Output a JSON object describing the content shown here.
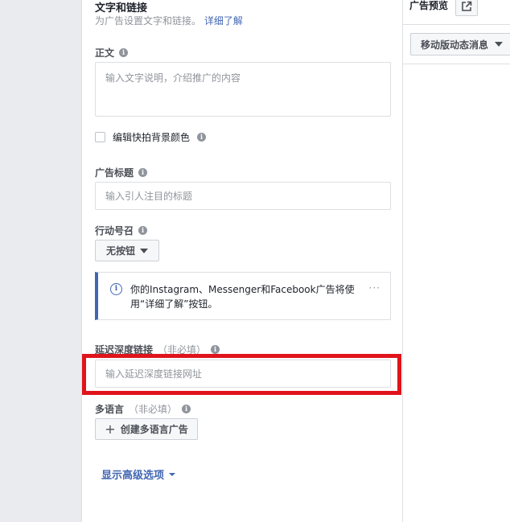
{
  "text_links": {
    "title": "文字和链接",
    "subtitle": "为广告设置文字和链接。",
    "learn_more": "详细了解"
  },
  "body_text": {
    "label": "正文",
    "placeholder": "输入文字说明，介绍推广的内容"
  },
  "snapshot_bg": {
    "label": "编辑快拍背景颜色"
  },
  "headline": {
    "label": "广告标题",
    "placeholder": "输入引人注目的标题"
  },
  "cta": {
    "label": "行动号召",
    "value": "无按钮"
  },
  "notice": {
    "text": "你的Instagram、Messenger和Facebook广告将使用“详细了解”按钮。",
    "more": "···"
  },
  "deep_link": {
    "label": "延迟深度链接",
    "optional": "（非必填）",
    "placeholder": "输入延迟深度链接网址"
  },
  "multilang": {
    "label": "多语言",
    "optional": "（非必填）",
    "button": "创建多语言广告"
  },
  "advanced": {
    "label": "显示高级选项"
  },
  "preview": {
    "title": "广告预览",
    "placement": "移动版动态消息"
  },
  "colors": {
    "accent": "#4267b2",
    "highlight": "#e0141b"
  }
}
